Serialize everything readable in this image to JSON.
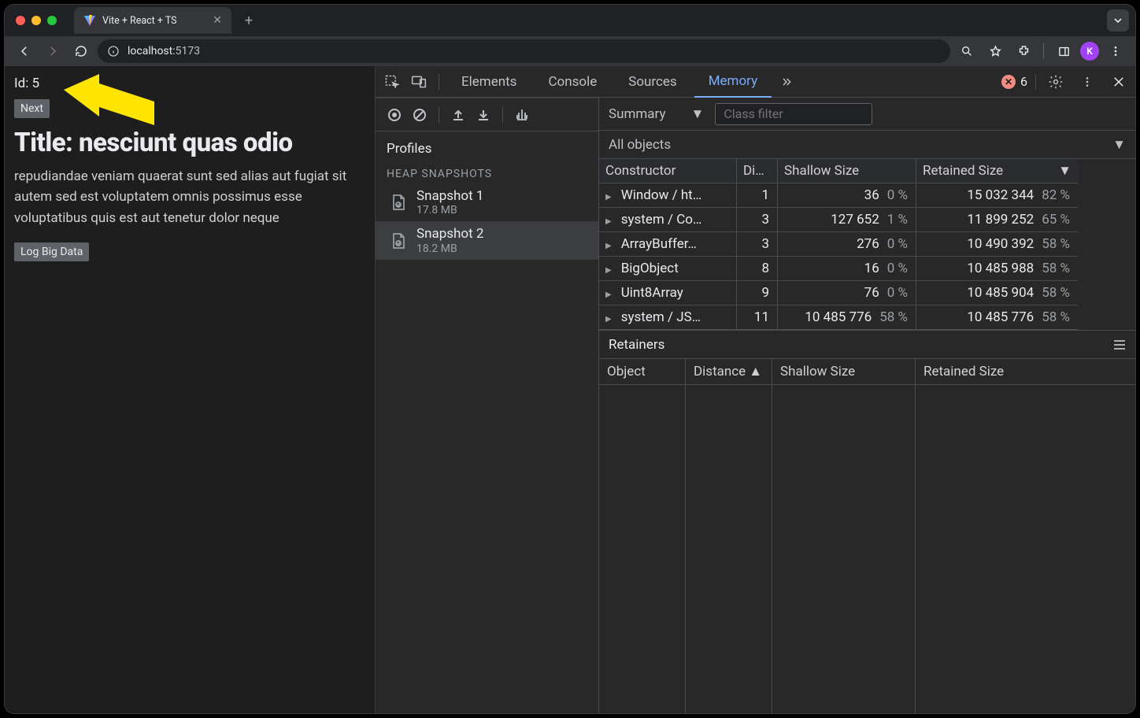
{
  "browser": {
    "tab_title": "Vite + React + TS",
    "url_host": "localhost:",
    "url_port": "5173",
    "profile_initial": "K"
  },
  "page": {
    "id_line": "Id: 5",
    "next_btn": "Next",
    "title": "Title: nesciunt quas odio",
    "body": "repudiandae veniam quaerat sunt sed alias aut fugiat sit autem sed est voluptatem omnis possimus esse voluptatibus quis est aut tenetur dolor neque",
    "log_btn": "Log Big Data"
  },
  "devtools": {
    "tabs": {
      "elements": "Elements",
      "console": "Console",
      "sources": "Sources",
      "memory": "Memory"
    },
    "error_count": "6"
  },
  "memory": {
    "sidebar": {
      "profiles_label": "Profiles",
      "section_label": "HEAP SNAPSHOTS",
      "snapshots": [
        {
          "name": "Snapshot 1",
          "size": "17.8 MB"
        },
        {
          "name": "Snapshot 2",
          "size": "18.2 MB"
        }
      ]
    },
    "view_dropdown": "Summary",
    "class_filter_placeholder": "Class filter",
    "scope_dropdown": "All objects",
    "columns": {
      "constructor": "Constructor",
      "distance": "Di…",
      "shallow": "Shallow Size",
      "retained": "Retained Size"
    },
    "rows": [
      {
        "name": "Window / ht…",
        "distance": "1",
        "shallow": "36",
        "shallow_pct": "0 %",
        "retained": "15 032 344",
        "retained_pct": "82 %"
      },
      {
        "name": "system / Co…",
        "distance": "3",
        "shallow": "127 652",
        "shallow_pct": "1 %",
        "retained": "11 899 252",
        "retained_pct": "65 %"
      },
      {
        "name": "ArrayBuffer…",
        "distance": "3",
        "shallow": "276",
        "shallow_pct": "0 %",
        "retained": "10 490 392",
        "retained_pct": "58 %"
      },
      {
        "name": "BigObject",
        "distance": "8",
        "shallow": "16",
        "shallow_pct": "0 %",
        "retained": "10 485 988",
        "retained_pct": "58 %"
      },
      {
        "name": "Uint8Array",
        "distance": "9",
        "shallow": "76",
        "shallow_pct": "0 %",
        "retained": "10 485 904",
        "retained_pct": "58 %"
      },
      {
        "name": "system / JS…",
        "distance": "11",
        "shallow": "10 485 776",
        "shallow_pct": "58 %",
        "retained": "10 485 776",
        "retained_pct": "58 %"
      }
    ],
    "retainers": {
      "title": "Retainers",
      "columns": {
        "object": "Object",
        "distance": "Distance",
        "shallow": "Shallow Size",
        "retained": "Retained Size"
      }
    }
  }
}
